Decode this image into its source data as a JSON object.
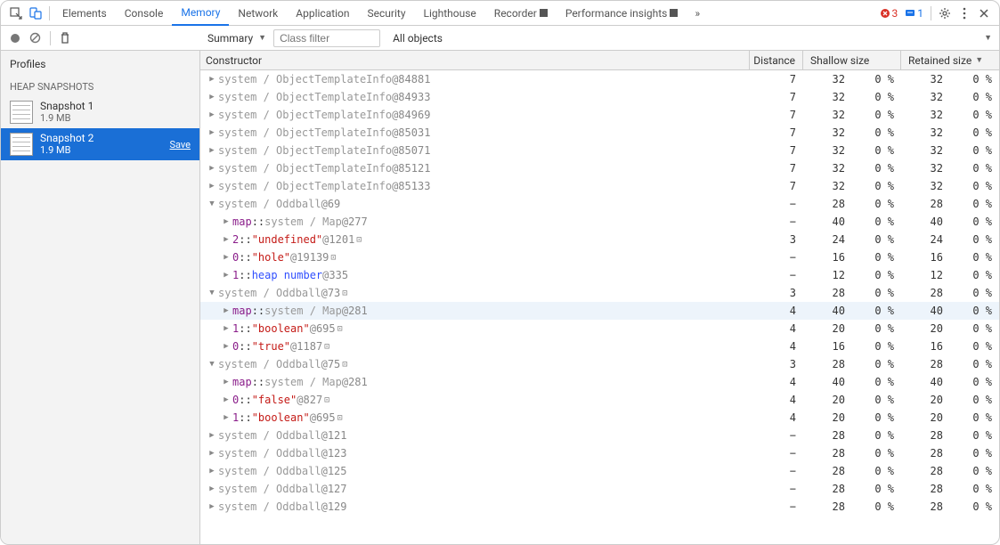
{
  "tabs": {
    "elements": "Elements",
    "console": "Console",
    "memory": "Memory",
    "network": "Network",
    "application": "Application",
    "security": "Security",
    "lighthouse": "Lighthouse",
    "recorder": "Recorder",
    "performance": "Performance insights"
  },
  "active_tab": "Memory",
  "errors": "3",
  "messages": "1",
  "toolbar": {
    "summary": "Summary",
    "filter_placeholder": "Class filter",
    "filter_value": "",
    "objects": "All objects"
  },
  "sidebar": {
    "profiles": "Profiles",
    "heap": "HEAP SNAPSHOTS",
    "snapshots": [
      {
        "name": "Snapshot 1",
        "size": "1.9 MB"
      },
      {
        "name": "Snapshot 2",
        "size": "1.9 MB"
      }
    ],
    "save": "Save"
  },
  "columns": {
    "constructor": "Constructor",
    "distance": "Distance",
    "shallow": "Shallow size",
    "retained": "Retained size"
  },
  "rows": [
    {
      "indent": 0,
      "expand": "closed",
      "parts": [
        {
          "t": "sys",
          "v": "system / ObjectTemplateInfo"
        },
        {
          "t": "at",
          "v": " @84881"
        }
      ],
      "dist": "7",
      "ss": "32",
      "sp": "0 %",
      "rs": "32",
      "rp": "0 %"
    },
    {
      "indent": 0,
      "expand": "closed",
      "parts": [
        {
          "t": "sys",
          "v": "system / ObjectTemplateInfo"
        },
        {
          "t": "at",
          "v": " @84933"
        }
      ],
      "dist": "7",
      "ss": "32",
      "sp": "0 %",
      "rs": "32",
      "rp": "0 %"
    },
    {
      "indent": 0,
      "expand": "closed",
      "parts": [
        {
          "t": "sys",
          "v": "system / ObjectTemplateInfo"
        },
        {
          "t": "at",
          "v": " @84969"
        }
      ],
      "dist": "7",
      "ss": "32",
      "sp": "0 %",
      "rs": "32",
      "rp": "0 %"
    },
    {
      "indent": 0,
      "expand": "closed",
      "parts": [
        {
          "t": "sys",
          "v": "system / ObjectTemplateInfo"
        },
        {
          "t": "at",
          "v": " @85031"
        }
      ],
      "dist": "7",
      "ss": "32",
      "sp": "0 %",
      "rs": "32",
      "rp": "0 %"
    },
    {
      "indent": 0,
      "expand": "closed",
      "parts": [
        {
          "t": "sys",
          "v": "system / ObjectTemplateInfo"
        },
        {
          "t": "at",
          "v": " @85071"
        }
      ],
      "dist": "7",
      "ss": "32",
      "sp": "0 %",
      "rs": "32",
      "rp": "0 %"
    },
    {
      "indent": 0,
      "expand": "closed",
      "parts": [
        {
          "t": "sys",
          "v": "system / ObjectTemplateInfo"
        },
        {
          "t": "at",
          "v": " @85121"
        }
      ],
      "dist": "7",
      "ss": "32",
      "sp": "0 %",
      "rs": "32",
      "rp": "0 %"
    },
    {
      "indent": 0,
      "expand": "closed",
      "parts": [
        {
          "t": "sys",
          "v": "system / ObjectTemplateInfo"
        },
        {
          "t": "at",
          "v": " @85133"
        }
      ],
      "dist": "7",
      "ss": "32",
      "sp": "0 %",
      "rs": "32",
      "rp": "0 %"
    },
    {
      "indent": 0,
      "expand": "open",
      "parts": [
        {
          "t": "sys",
          "v": "system / Oddball"
        },
        {
          "t": "at",
          "v": " @69"
        }
      ],
      "dist": "−",
      "ss": "28",
      "sp": "0 %",
      "rs": "28",
      "rp": "0 %"
    },
    {
      "indent": 1,
      "expand": "closed",
      "parts": [
        {
          "t": "key",
          "v": "map"
        },
        {
          "t": "plain",
          "v": " :: "
        },
        {
          "t": "sys",
          "v": "system / Map"
        },
        {
          "t": "at",
          "v": " @277"
        }
      ],
      "dist": "−",
      "ss": "40",
      "sp": "0 %",
      "rs": "40",
      "rp": "0 %"
    },
    {
      "indent": 1,
      "expand": "closed",
      "parts": [
        {
          "t": "key",
          "v": "2"
        },
        {
          "t": "plain",
          "v": " :: "
        },
        {
          "t": "str",
          "v": "\"undefined\""
        },
        {
          "t": "at",
          "v": " @1201"
        },
        {
          "t": "box",
          "v": "⊡"
        }
      ],
      "dist": "3",
      "ss": "24",
      "sp": "0 %",
      "rs": "24",
      "rp": "0 %"
    },
    {
      "indent": 1,
      "expand": "closed",
      "parts": [
        {
          "t": "key",
          "v": "0"
        },
        {
          "t": "plain",
          "v": " :: "
        },
        {
          "t": "str",
          "v": "\"hole\""
        },
        {
          "t": "at",
          "v": " @19139"
        },
        {
          "t": "box",
          "v": "⊡"
        }
      ],
      "dist": "−",
      "ss": "16",
      "sp": "0 %",
      "rs": "16",
      "rp": "0 %"
    },
    {
      "indent": 1,
      "expand": "closed",
      "parts": [
        {
          "t": "key",
          "v": "1"
        },
        {
          "t": "plain",
          "v": " :: "
        },
        {
          "t": "prop",
          "v": "heap number"
        },
        {
          "t": "at",
          "v": " @335"
        }
      ],
      "dist": "−",
      "ss": "12",
      "sp": "0 %",
      "rs": "12",
      "rp": "0 %"
    },
    {
      "indent": 0,
      "expand": "open",
      "parts": [
        {
          "t": "sys",
          "v": "system / Oddball"
        },
        {
          "t": "at",
          "v": " @73"
        },
        {
          "t": "box",
          "v": "⊡"
        }
      ],
      "dist": "3",
      "ss": "28",
      "sp": "0 %",
      "rs": "28",
      "rp": "0 %"
    },
    {
      "indent": 1,
      "expand": "closed",
      "hl": true,
      "parts": [
        {
          "t": "key",
          "v": "map"
        },
        {
          "t": "plain",
          "v": " :: "
        },
        {
          "t": "sys",
          "v": "system / Map"
        },
        {
          "t": "at",
          "v": " @281"
        }
      ],
      "dist": "4",
      "ss": "40",
      "sp": "0 %",
      "rs": "40",
      "rp": "0 %"
    },
    {
      "indent": 1,
      "expand": "closed",
      "parts": [
        {
          "t": "key",
          "v": "1"
        },
        {
          "t": "plain",
          "v": " :: "
        },
        {
          "t": "str",
          "v": "\"boolean\""
        },
        {
          "t": "at",
          "v": " @695"
        },
        {
          "t": "box",
          "v": "⊡"
        }
      ],
      "dist": "4",
      "ss": "20",
      "sp": "0 %",
      "rs": "20",
      "rp": "0 %"
    },
    {
      "indent": 1,
      "expand": "closed",
      "parts": [
        {
          "t": "key",
          "v": "0"
        },
        {
          "t": "plain",
          "v": " :: "
        },
        {
          "t": "str",
          "v": "\"true\""
        },
        {
          "t": "at",
          "v": " @1187"
        },
        {
          "t": "box",
          "v": "⊡"
        }
      ],
      "dist": "4",
      "ss": "16",
      "sp": "0 %",
      "rs": "16",
      "rp": "0 %"
    },
    {
      "indent": 0,
      "expand": "open",
      "parts": [
        {
          "t": "sys",
          "v": "system / Oddball"
        },
        {
          "t": "at",
          "v": " @75"
        },
        {
          "t": "box",
          "v": "⊡"
        }
      ],
      "dist": "3",
      "ss": "28",
      "sp": "0 %",
      "rs": "28",
      "rp": "0 %"
    },
    {
      "indent": 1,
      "expand": "closed",
      "parts": [
        {
          "t": "key",
          "v": "map"
        },
        {
          "t": "plain",
          "v": " :: "
        },
        {
          "t": "sys",
          "v": "system / Map"
        },
        {
          "t": "at",
          "v": " @281"
        }
      ],
      "dist": "4",
      "ss": "40",
      "sp": "0 %",
      "rs": "40",
      "rp": "0 %"
    },
    {
      "indent": 1,
      "expand": "closed",
      "parts": [
        {
          "t": "key",
          "v": "0"
        },
        {
          "t": "plain",
          "v": " :: "
        },
        {
          "t": "str",
          "v": "\"false\""
        },
        {
          "t": "at",
          "v": " @827"
        },
        {
          "t": "box",
          "v": "⊡"
        }
      ],
      "dist": "4",
      "ss": "20",
      "sp": "0 %",
      "rs": "20",
      "rp": "0 %"
    },
    {
      "indent": 1,
      "expand": "closed",
      "parts": [
        {
          "t": "key",
          "v": "1"
        },
        {
          "t": "plain",
          "v": " :: "
        },
        {
          "t": "str",
          "v": "\"boolean\""
        },
        {
          "t": "at",
          "v": " @695"
        },
        {
          "t": "box",
          "v": "⊡"
        }
      ],
      "dist": "4",
      "ss": "20",
      "sp": "0 %",
      "rs": "20",
      "rp": "0 %"
    },
    {
      "indent": 0,
      "expand": "closed",
      "parts": [
        {
          "t": "sys",
          "v": "system / Oddball"
        },
        {
          "t": "at",
          "v": " @121"
        }
      ],
      "dist": "−",
      "ss": "28",
      "sp": "0 %",
      "rs": "28",
      "rp": "0 %"
    },
    {
      "indent": 0,
      "expand": "closed",
      "parts": [
        {
          "t": "sys",
          "v": "system / Oddball"
        },
        {
          "t": "at",
          "v": " @123"
        }
      ],
      "dist": "−",
      "ss": "28",
      "sp": "0 %",
      "rs": "28",
      "rp": "0 %"
    },
    {
      "indent": 0,
      "expand": "closed",
      "parts": [
        {
          "t": "sys",
          "v": "system / Oddball"
        },
        {
          "t": "at",
          "v": " @125"
        }
      ],
      "dist": "−",
      "ss": "28",
      "sp": "0 %",
      "rs": "28",
      "rp": "0 %"
    },
    {
      "indent": 0,
      "expand": "closed",
      "parts": [
        {
          "t": "sys",
          "v": "system / Oddball"
        },
        {
          "t": "at",
          "v": " @127"
        }
      ],
      "dist": "−",
      "ss": "28",
      "sp": "0 %",
      "rs": "28",
      "rp": "0 %"
    },
    {
      "indent": 0,
      "expand": "closed",
      "parts": [
        {
          "t": "sys",
          "v": "system / Oddball"
        },
        {
          "t": "at",
          "v": " @129"
        }
      ],
      "dist": "−",
      "ss": "28",
      "sp": "0 %",
      "rs": "28",
      "rp": "0 %"
    }
  ]
}
